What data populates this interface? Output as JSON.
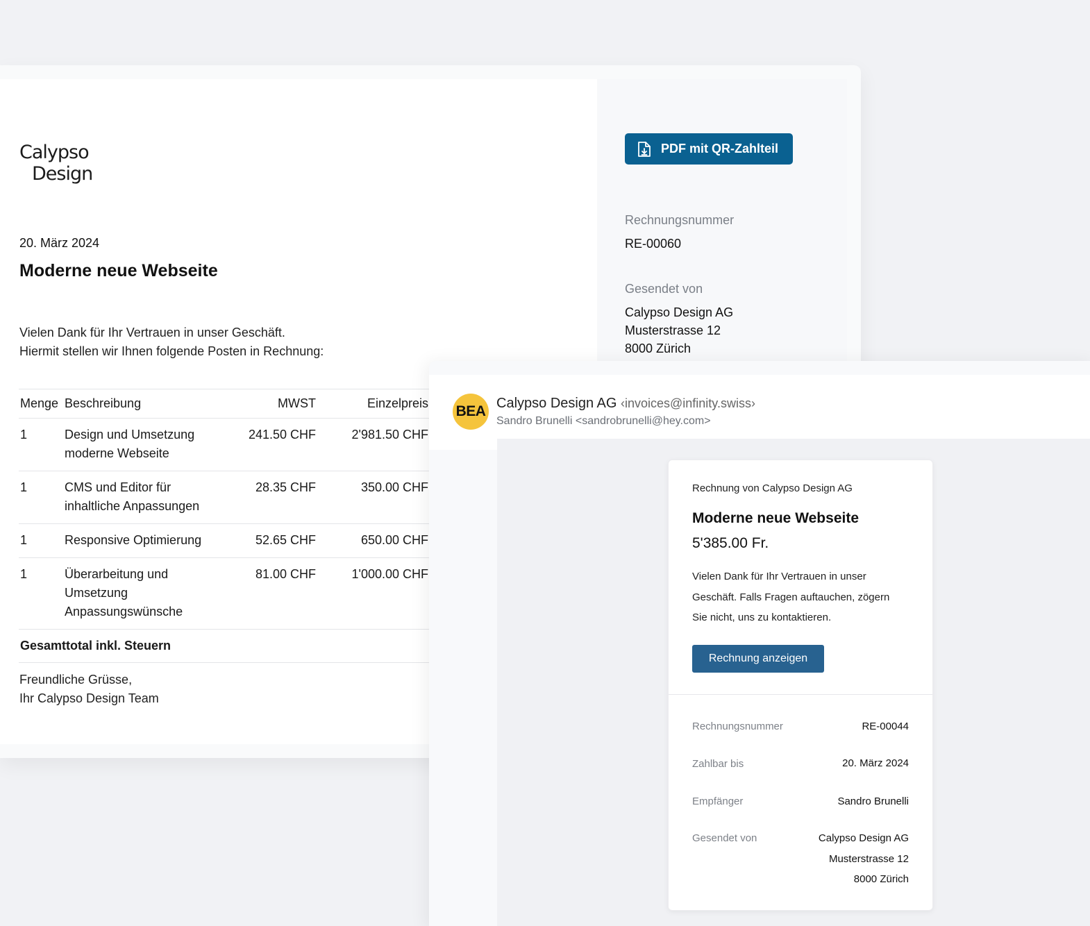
{
  "invoice": {
    "logo": {
      "line1": "Calypso",
      "line2": "Design"
    },
    "date": "20. März 2024",
    "title": "Moderne neue Webseite",
    "intro_line1": "Vielen Dank für Ihr Vertrauen in unser Geschäft.",
    "intro_line2": "Hiermit stellen wir Ihnen folgende Posten in Rechnung:",
    "table": {
      "headers": {
        "qty": "Menge",
        "desc": "Beschreibung",
        "vat": "MWST",
        "price": "Einzelpreis"
      },
      "rows": [
        {
          "qty": "1",
          "desc": "Design und Umsetzung moderne Webseite",
          "vat": "241.50 CHF",
          "price": "2'981.50 CHF"
        },
        {
          "qty": "1",
          "desc": "CMS und Editor für inhaltliche Anpassungen",
          "vat": "28.35 CHF",
          "price": "350.00 CHF"
        },
        {
          "qty": "1",
          "desc": "Responsive Optimierung",
          "vat": "52.65 CHF",
          "price": "650.00 CHF"
        },
        {
          "qty": "1",
          "desc": "Überarbeitung und Umsetzung Anpassungswünsche",
          "vat": "81.00 CHF",
          "price": "1'000.00 CHF"
        }
      ],
      "total_label": "Gesamttotal inkl. Steuern"
    },
    "closing_line1": "Freundliche Grüsse,",
    "closing_line2": "Ihr Calypso Design Team",
    "sidebar": {
      "pdf_button_label": "PDF mit QR-Zahlteil",
      "pdf_icon": "file-download-icon",
      "number_label": "Rechnungsnummer",
      "number_value": "RE-00060",
      "sender_label": "Gesendet von",
      "sender_line1": "Calypso Design AG",
      "sender_line2": "Musterstrasse 12",
      "sender_line3": "8000 Zürich"
    }
  },
  "email": {
    "avatar_text": "BEA",
    "avatar_color": "#f5c43c",
    "sender_name": "Calypso Design AG",
    "sender_email": "‹invoices@infinity.swiss›",
    "recipient": "Sandro Brunelli <sandrobrunelli@hey.com>",
    "card": {
      "from": "Rechnung von Calypso Design AG",
      "title": "Moderne neue Webseite",
      "amount": "5'385.00 Fr.",
      "text": "Vielen Dank für Ihr Vertrauen in unser Geschäft. Falls Fragen auftauchen, zögern Sie nicht, uns zu kontaktieren.",
      "button_label": "Rechnung anzeigen",
      "details": {
        "number_label": "Rechnungsnummer",
        "number_value": "RE-00044",
        "due_label": "Zahlbar bis",
        "due_value": "20. März 2024",
        "recipient_label": "Empfänger",
        "recipient_value": "Sandro Brunelli",
        "sender_label": "Gesendet von",
        "sender_line1": "Calypso Design AG",
        "sender_line2": "Musterstrasse 12",
        "sender_line3": "8000 Zürich"
      }
    }
  },
  "colors": {
    "accent": "#0a6191",
    "button": "#286290",
    "background": "#f1f2f5"
  }
}
